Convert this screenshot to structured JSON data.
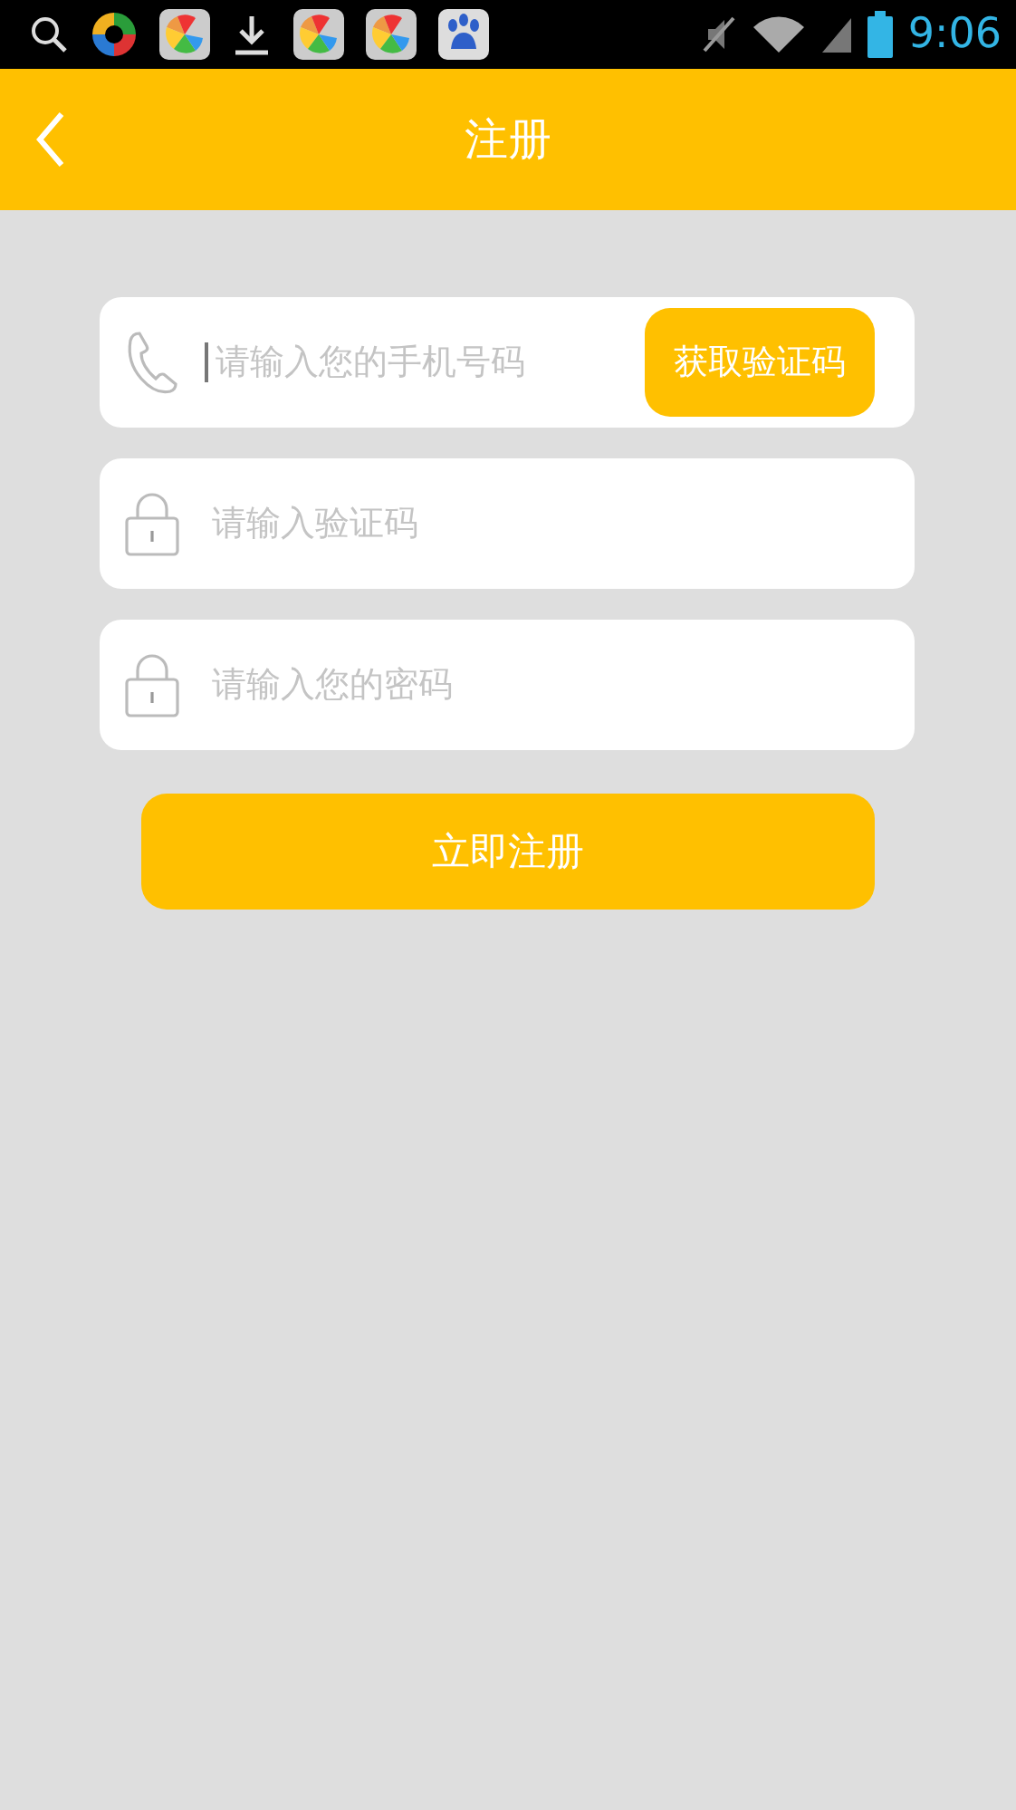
{
  "status_bar": {
    "time": "9:06"
  },
  "header": {
    "title": "注册"
  },
  "fields": [
    {
      "kind": "phone",
      "placeholder": "请输入您的手机号码",
      "focused": true,
      "button": "获取验证码"
    },
    {
      "kind": "lock",
      "placeholder": "请输入验证码",
      "focused": false
    },
    {
      "kind": "lock",
      "placeholder": "请输入您的密码",
      "focused": false
    }
  ],
  "submit": "立即注册"
}
